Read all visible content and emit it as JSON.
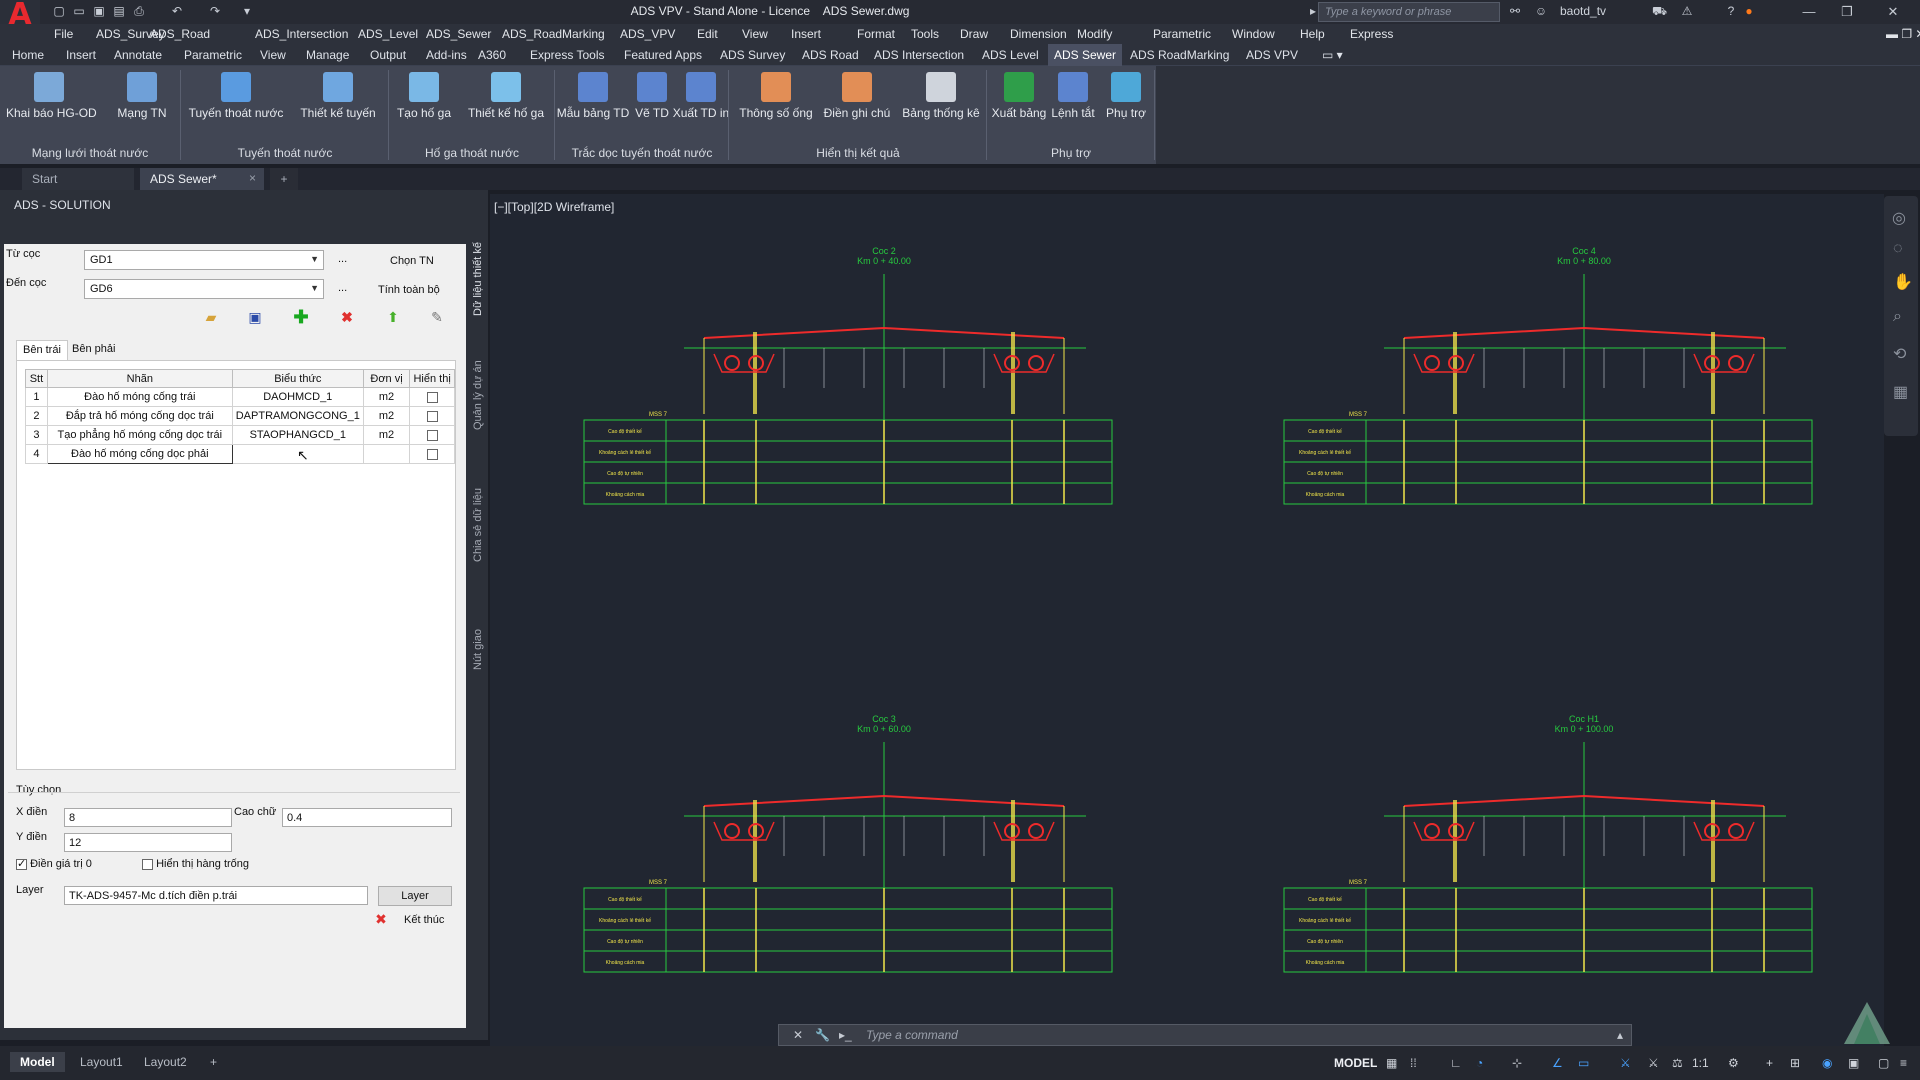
{
  "titlebar": {
    "app_title": "ADS VPV - Stand Alone - Licence",
    "file_name": "ADS Sewer.dwg",
    "search_placeholder": "Type a keyword or phrase",
    "user": "baotd_tv"
  },
  "menu": [
    "File",
    "ADS_Survey",
    "ADS_Road",
    "ADS_Intersection",
    "ADS_Level",
    "ADS_Sewer",
    "ADS_RoadMarking",
    "ADS_VPV",
    "Edit",
    "View",
    "Insert",
    "Format",
    "Tools",
    "Draw",
    "Dimension",
    "Modify",
    "Parametric",
    "Window",
    "Help",
    "Express"
  ],
  "ribbon_tabs": [
    "Home",
    "Insert",
    "Annotate",
    "Parametric",
    "View",
    "Manage",
    "Output",
    "Add-ins",
    "A360",
    "Express Tools",
    "Featured Apps",
    "ADS Survey",
    "ADS Road",
    "ADS Intersection",
    "ADS Level",
    "ADS Sewer",
    "ADS RoadMarking",
    "ADS VPV"
  ],
  "ribbon_active": "ADS Sewer",
  "ribbon_buttons": [
    "Khai báo HG-OD",
    "Mạng TN",
    "Tuyến thoát nước",
    "Thiết kế tuyến",
    "Tạo hố ga",
    "Thiết kế hố ga",
    "Mẫu bảng TD",
    "Vẽ TD",
    "Xuất TD in",
    "Thông số ống",
    "Điền ghi chú",
    "Bảng thống kê",
    "Xuất bảng",
    "Lệnh tắt",
    "Phụ trợ"
  ],
  "ribbon_panels": [
    "Mạng lưới thoát nước",
    "Tuyến thoát nước",
    "Hố ga thoát nước",
    "Trắc dọc tuyến thoát nước",
    "Hiển thị kết quả",
    "Phụ trợ"
  ],
  "doc_tabs": [
    "Start",
    "ADS Sewer*"
  ],
  "palette": {
    "title": "ADS - SOLUTION",
    "tu_coc_label": "Từ cọc",
    "tu_coc_value": "GD1",
    "den_coc_label": "Đến cọc",
    "den_coc_value": "GD6",
    "ellipsis": "...",
    "chon_tn": "Chọn TN",
    "tinh_toan_bo": "Tính toàn bộ",
    "tab_left": "Bên trái",
    "tab_right": "Bên phải",
    "columns": [
      "Stt",
      "Nhãn",
      "Biểu thức",
      "Đơn vị",
      "Hiển thị"
    ],
    "rows": [
      {
        "stt": "1",
        "nhan": "Đào hố móng cống trái",
        "bieu_thuc": "DAOHMCD_1",
        "don_vi": "m2"
      },
      {
        "stt": "2",
        "nhan": "Đắp trả hố móng cống dọc trái",
        "bieu_thuc": "DAPTRAMONGCONG_1",
        "don_vi": "m2"
      },
      {
        "stt": "3",
        "nhan": "Tạo phẳng hố móng cống dọc trái",
        "bieu_thuc": "STAOPHANGCD_1",
        "don_vi": "m2"
      },
      {
        "stt": "4",
        "nhan": "Đào hố móng cống dọc phải",
        "bieu_thuc": "",
        "don_vi": ""
      }
    ],
    "options_title": "Tùy chọn",
    "x_dien_label": "X điền",
    "x_dien_value": "8",
    "cao_chu_label": "Cao chữ",
    "cao_chu_value": "0.4",
    "y_dien_label": "Y điền",
    "y_dien_value": "12",
    "dien_gia_tri_0": "Điền giá trị 0",
    "hien_thi_hang_trong": "Hiển thị hàng trống",
    "layer_label": "Layer",
    "layer_value": "TK-ADS-9457-Mc d.tích điền p.trái",
    "layer_button": "Layer",
    "ket_thuc": "Kết thúc",
    "vertical_tabs": [
      "Dữ liệu thiết kế",
      "Quản lý dự án",
      "Chia sẻ dữ liệu",
      "Nút giao"
    ]
  },
  "canvas": {
    "view_label": "[−][Top][2D Wireframe]",
    "sections": [
      {
        "title": "Coc 2",
        "km": "Km 0 + 40.00"
      },
      {
        "title": "Coc 4",
        "km": "Km 0 + 80.00"
      },
      {
        "title": "Coc 3",
        "km": "Km 0 + 60.00"
      },
      {
        "title": "Coc H1",
        "km": "Km 0 + 100.00"
      }
    ],
    "table_rows": [
      "Cao độ thiết kế",
      "Khoảng cách lẻ thiết kế",
      "Cao độ tự nhiên",
      "Khoảng cách mia"
    ],
    "mss_label": "MSS 7"
  },
  "command": {
    "placeholder": "Type a command"
  },
  "status": {
    "tabs": [
      "Model",
      "Layout1",
      "Layout2"
    ],
    "model": "MODEL",
    "scale": "1:1"
  },
  "colors": {
    "accent": "#4a5062",
    "drawing_green": "#27c93f",
    "drawing_yellow": "#f2e64a",
    "drawing_red": "#ee2b2b"
  }
}
